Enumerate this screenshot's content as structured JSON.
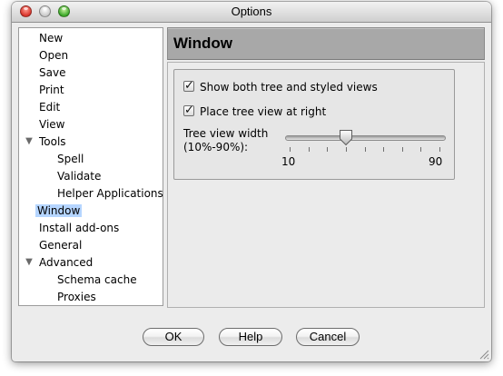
{
  "window": {
    "title": "Options"
  },
  "sidebar": {
    "items": [
      {
        "label": "New"
      },
      {
        "label": "Open"
      },
      {
        "label": "Save"
      },
      {
        "label": "Print"
      },
      {
        "label": "Edit"
      },
      {
        "label": "View"
      },
      {
        "label": "Tools",
        "expanded": true
      },
      {
        "label": "Spell"
      },
      {
        "label": "Validate"
      },
      {
        "label": "Helper Applications"
      },
      {
        "label": "Window",
        "selected": true
      },
      {
        "label": "Install add-ons"
      },
      {
        "label": "General"
      },
      {
        "label": "Advanced",
        "expanded": true
      },
      {
        "label": "Schema cache"
      },
      {
        "label": "Proxies"
      }
    ],
    "disclosure_glyph": "▼"
  },
  "panel": {
    "title": "Window",
    "show_both_views": {
      "label": "Show both tree and styled views",
      "checked": true
    },
    "tree_view_right": {
      "label": "Place tree view at right",
      "checked": true
    },
    "slider": {
      "label_line1": "Tree view width",
      "label_line2": "(10%-90%):",
      "min_label": "10",
      "max_label": "90",
      "value": 40,
      "min": 10,
      "max": 90
    },
    "check_glyph": "✓"
  },
  "buttons": {
    "ok": "OK",
    "help": "Help",
    "cancel": "Cancel"
  },
  "colors": {
    "selection": "#b5d5ff",
    "header_bg": "#a8a8a8",
    "window_bg": "#ececec"
  }
}
